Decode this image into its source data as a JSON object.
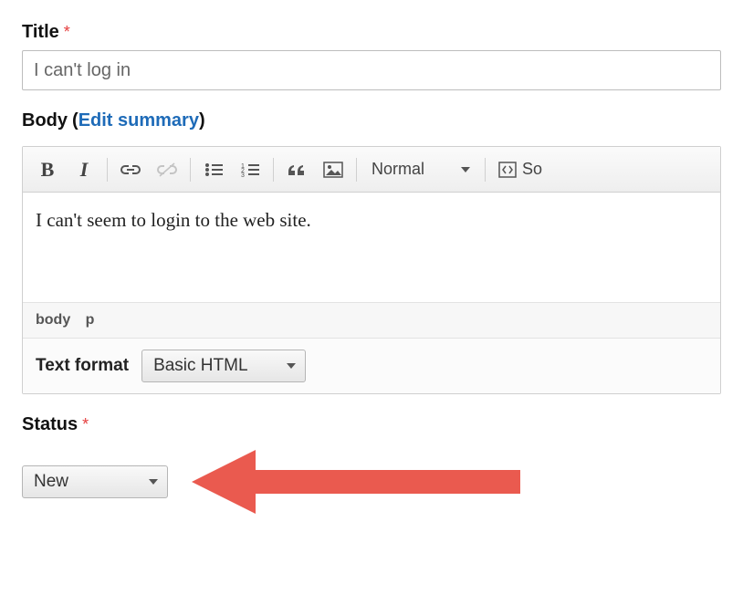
{
  "title": {
    "label": "Title",
    "required": "*",
    "value": "I can't log in"
  },
  "body": {
    "label": "Body",
    "edit_summary_text": "Edit summary",
    "content": "I can't seem to login to the web site.",
    "path": {
      "body": "body",
      "p": "p"
    },
    "format_label": "Text format",
    "format_value": "Basic HTML"
  },
  "toolbar": {
    "bold": "B",
    "italic": "I",
    "quote": "99",
    "format_name": "Normal",
    "source_label": "So"
  },
  "status": {
    "label": "Status",
    "required": "*",
    "value": "New"
  }
}
